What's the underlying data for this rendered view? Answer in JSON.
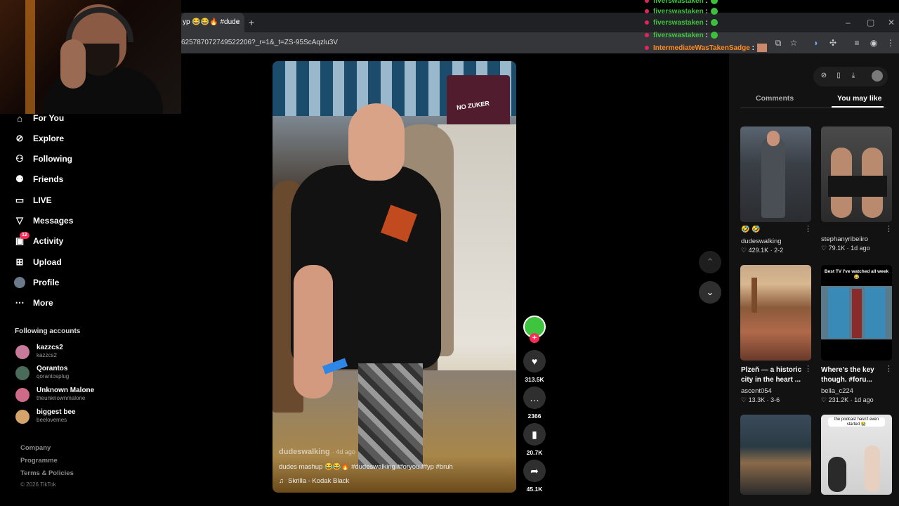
{
  "browser": {
    "tab_title": "yp 😂😂🔥 #dude",
    "tab_close": "×",
    "new_tab": "+",
    "url": "625787072749522206?_r=1&_t=ZS-95ScAqzlu3V",
    "window_controls": [
      "–",
      "▢",
      "✕"
    ]
  },
  "chat": [
    {
      "user": "fiverswastaken",
      "sep": ":",
      "color": "#3ec43e"
    },
    {
      "user": "fiverswastaken",
      "sep": ":",
      "color": "#3ec43e"
    },
    {
      "user": "fiverswastaken",
      "sep": ":",
      "color": "#3ec43e"
    },
    {
      "user": "fiverswastaken",
      "sep": ":",
      "color": "#3ec43e"
    },
    {
      "user": "IntermediateWasTakenSadge",
      "sep": ":",
      "color": "#ff8a1e"
    }
  ],
  "sidebar": {
    "items": [
      {
        "label": "For You",
        "icon": "home-icon"
      },
      {
        "label": "Explore",
        "icon": "compass-icon"
      },
      {
        "label": "Following",
        "icon": "following-icon"
      },
      {
        "label": "Friends",
        "icon": "friends-icon"
      },
      {
        "label": "LIVE",
        "icon": "live-icon"
      },
      {
        "label": "Messages",
        "icon": "messages-icon"
      },
      {
        "label": "Activity",
        "icon": "activity-icon",
        "badge": "12"
      },
      {
        "label": "Upload",
        "icon": "upload-icon"
      },
      {
        "label": "Profile",
        "icon": "avatar"
      },
      {
        "label": "More",
        "icon": "more-icon"
      }
    ],
    "following_title": "Following accounts",
    "accounts": [
      {
        "name": "kazzcs2",
        "handle": "kazzcs2",
        "color": "#c87a9a"
      },
      {
        "name": "Qorantos",
        "handle": "qorantosplug",
        "color": "#4a6a5a"
      },
      {
        "name": "Unknown Malone",
        "handle": "theunknownmalone",
        "color": "#d06a8a"
      },
      {
        "name": "biggest bee",
        "handle": "beelovemes",
        "color": "#d4a46a"
      }
    ],
    "footer": [
      "Company",
      "Programme",
      "Terms & Policies"
    ],
    "copyright": "© 2026 TikTok"
  },
  "video": {
    "author": "dudeswalking",
    "age": "· 4d ago",
    "caption": "dudes mashup 😂😂🔥 #dudeswalking #foryou #fyp #bruh",
    "sound": "Skrilla - Kodak Black",
    "sign": "NO ZUKER"
  },
  "actions": {
    "likes": "313.5K",
    "comments": "2366",
    "saves": "20.7K",
    "shares": "45.1K"
  },
  "panel": {
    "tabs": [
      "Comments",
      "You may like"
    ],
    "videos": [
      {
        "title": "🤣 🤣",
        "author": "dudeswalking",
        "stats": "♡ 429.1K · 2-2",
        "overlay": ""
      },
      {
        "title": "",
        "author": "stephanyribeiiro",
        "stats": "♡ 79.1K · 1d ago",
        "overlay": ""
      },
      {
        "title": "Plzeň — a historic city in the heart ...",
        "author": "ascent054",
        "stats": "♡ 13.3K · 3-6",
        "overlay": ""
      },
      {
        "title": "Where's the key though. #foru...",
        "author": "bella_c224",
        "stats": "♡ 231.2K · 1d ago",
        "overlay": "Best TV I've watched all week 😂"
      },
      {
        "title": "",
        "author": "",
        "stats": "",
        "overlay": ""
      },
      {
        "title": "",
        "author": "",
        "stats": "",
        "overlay": "the podcast hasn't even started 😭"
      }
    ]
  }
}
